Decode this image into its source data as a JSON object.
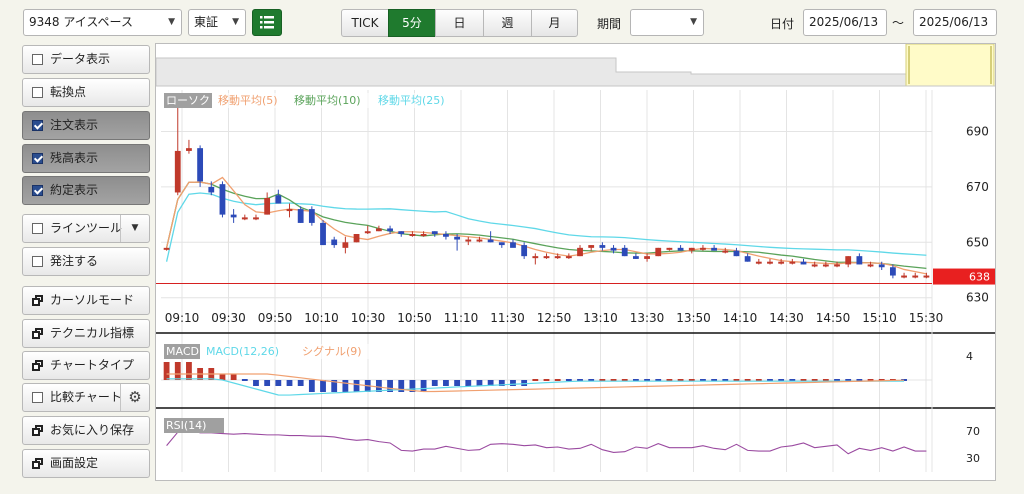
{
  "toolbar": {
    "symbol": "9348 アイスペース",
    "exchange": "東証",
    "list_icon": "list-icon",
    "periods": [
      "TICK",
      "5分",
      "日",
      "週",
      "月"
    ],
    "active_period": "5分",
    "period_label": "期間",
    "period_value": "",
    "date_label": "日付",
    "date_from": "2025/06/13",
    "tilde": "〜",
    "date_to": "2025/06/13"
  },
  "sidebar": {
    "items": [
      {
        "label": "データ表示",
        "kind": "check",
        "checked": false
      },
      {
        "label": "転換点",
        "kind": "check",
        "checked": false
      },
      {
        "label": "注文表示",
        "kind": "check",
        "checked": true
      },
      {
        "label": "残高表示",
        "kind": "check",
        "checked": true
      },
      {
        "label": "約定表示",
        "kind": "check",
        "checked": true
      },
      {
        "label": "ラインツール",
        "kind": "check-dropdown",
        "checked": false
      },
      {
        "label": "発注する",
        "kind": "check",
        "checked": false
      },
      {
        "label": "カーソルモード",
        "kind": "window"
      },
      {
        "label": "テクニカル指標",
        "kind": "window"
      },
      {
        "label": "チャートタイプ",
        "kind": "window"
      },
      {
        "label": "比較チャート",
        "kind": "check-gear",
        "checked": false
      },
      {
        "label": "お気に入り保存",
        "kind": "window"
      },
      {
        "label": "画面設定",
        "kind": "window"
      }
    ]
  },
  "main_chart": {
    "legend": [
      "ローソク",
      "移動平均(5)",
      "移動平均(10)",
      "移動平均(25)"
    ],
    "price_ticks": [
      "690",
      "670",
      "650",
      "630"
    ],
    "current_price": "638",
    "time_labels": [
      "09:10",
      "09:30",
      "09:50",
      "10:10",
      "10:30",
      "10:50",
      "11:10",
      "11:30",
      "12:50",
      "13:10",
      "13:30",
      "13:50",
      "14:10",
      "14:30",
      "14:50",
      "15:10",
      "15:30"
    ]
  },
  "macd": {
    "legend": [
      "MACD",
      "MACD(12,26)",
      "シグナル(9)"
    ],
    "tick": "4"
  },
  "rsi": {
    "legend": [
      "RSI(14)"
    ],
    "ticks": [
      "70",
      "30"
    ]
  },
  "colors": {
    "up": "#c0392b",
    "down": "#2c4ab8",
    "ma5": "#f0a070",
    "ma10": "#5aa35a",
    "ma25": "#5fd8e8",
    "macd": "#5fd8e8",
    "signal": "#f0a070",
    "rsi": "#9a4aa0",
    "active_green": "#1f7a2e"
  },
  "chart_data": {
    "type": "candlestick",
    "candles": [
      {
        "o": 648,
        "h": 648,
        "l": 647,
        "c": 648
      },
      {
        "o": 668,
        "h": 700,
        "l": 667,
        "c": 683
      },
      {
        "o": 683,
        "h": 687,
        "l": 682,
        "c": 684
      },
      {
        "o": 684,
        "h": 685,
        "l": 670,
        "c": 672
      },
      {
        "o": 670,
        "h": 672,
        "l": 667,
        "c": 668
      },
      {
        "o": 671,
        "h": 672,
        "l": 659,
        "c": 660
      },
      {
        "o": 660,
        "h": 662,
        "l": 657,
        "c": 659
      },
      {
        "o": 659,
        "h": 660,
        "l": 658,
        "c": 659
      },
      {
        "o": 659,
        "h": 660,
        "l": 658,
        "c": 659
      },
      {
        "o": 660,
        "h": 668,
        "l": 660,
        "c": 666
      },
      {
        "o": 667,
        "h": 669,
        "l": 664,
        "c": 664
      },
      {
        "o": 662,
        "h": 664,
        "l": 659,
        "c": 662
      },
      {
        "o": 662,
        "h": 663,
        "l": 657,
        "c": 657
      },
      {
        "o": 662,
        "h": 663,
        "l": 656,
        "c": 657
      },
      {
        "o": 657,
        "h": 658,
        "l": 649,
        "c": 649
      },
      {
        "o": 651,
        "h": 652,
        "l": 648,
        "c": 649
      },
      {
        "o": 648,
        "h": 652,
        "l": 646,
        "c": 650
      },
      {
        "o": 650,
        "h": 653,
        "l": 650,
        "c": 653
      },
      {
        "o": 654,
        "h": 656,
        "l": 653,
        "c": 654
      },
      {
        "o": 654,
        "h": 656,
        "l": 654,
        "c": 655
      },
      {
        "o": 655,
        "h": 656,
        "l": 653,
        "c": 654
      },
      {
        "o": 654,
        "h": 654,
        "l": 652,
        "c": 653
      },
      {
        "o": 653,
        "h": 654,
        "l": 652,
        "c": 653
      },
      {
        "o": 653,
        "h": 654,
        "l": 652,
        "c": 653
      },
      {
        "o": 654,
        "h": 654,
        "l": 652,
        "c": 653
      },
      {
        "o": 653,
        "h": 654,
        "l": 651,
        "c": 652
      },
      {
        "o": 652,
        "h": 653,
        "l": 647,
        "c": 651
      },
      {
        "o": 651,
        "h": 652,
        "l": 649,
        "c": 651
      },
      {
        "o": 651,
        "h": 652,
        "l": 650,
        "c": 651
      },
      {
        "o": 651,
        "h": 654,
        "l": 650,
        "c": 650
      },
      {
        "o": 650,
        "h": 650,
        "l": 648,
        "c": 649
      },
      {
        "o": 650,
        "h": 651,
        "l": 649,
        "c": 648
      },
      {
        "o": 649,
        "h": 650,
        "l": 644,
        "c": 645
      },
      {
        "o": 645,
        "h": 646,
        "l": 642,
        "c": 645
      },
      {
        "o": 645,
        "h": 646,
        "l": 644,
        "c": 645
      },
      {
        "o": 645,
        "h": 646,
        "l": 644,
        "c": 645
      },
      {
        "o": 645,
        "h": 646,
        "l": 644,
        "c": 645
      },
      {
        "o": 645,
        "h": 649,
        "l": 645,
        "c": 648
      },
      {
        "o": 648,
        "h": 649,
        "l": 647,
        "c": 649
      },
      {
        "o": 649,
        "h": 650,
        "l": 647,
        "c": 648
      },
      {
        "o": 648,
        "h": 649,
        "l": 646,
        "c": 647
      },
      {
        "o": 648,
        "h": 649,
        "l": 645,
        "c": 645
      },
      {
        "o": 645,
        "h": 646,
        "l": 644,
        "c": 644
      },
      {
        "o": 644,
        "h": 646,
        "l": 643,
        "c": 645
      },
      {
        "o": 645,
        "h": 648,
        "l": 645,
        "c": 648
      },
      {
        "o": 648,
        "h": 648,
        "l": 647,
        "c": 648
      },
      {
        "o": 648,
        "h": 649,
        "l": 647,
        "c": 647
      },
      {
        "o": 647,
        "h": 648,
        "l": 646,
        "c": 648
      },
      {
        "o": 648,
        "h": 649,
        "l": 647,
        "c": 648
      },
      {
        "o": 648,
        "h": 649,
        "l": 647,
        "c": 647
      },
      {
        "o": 647,
        "h": 648,
        "l": 646,
        "c": 647
      },
      {
        "o": 647,
        "h": 648,
        "l": 645,
        "c": 645
      },
      {
        "o": 645,
        "h": 646,
        "l": 643,
        "c": 643
      },
      {
        "o": 643,
        "h": 644,
        "l": 642,
        "c": 643
      },
      {
        "o": 643,
        "h": 644,
        "l": 642,
        "c": 643
      },
      {
        "o": 643,
        "h": 644,
        "l": 642,
        "c": 643
      },
      {
        "o": 643,
        "h": 644,
        "l": 642,
        "c": 643
      },
      {
        "o": 643,
        "h": 644,
        "l": 642,
        "c": 642
      },
      {
        "o": 642,
        "h": 643,
        "l": 641,
        "c": 642
      },
      {
        "o": 642,
        "h": 643,
        "l": 641,
        "c": 642
      },
      {
        "o": 642,
        "h": 643,
        "l": 641,
        "c": 642
      },
      {
        "o": 642,
        "h": 645,
        "l": 641,
        "c": 645
      },
      {
        "o": 645,
        "h": 646,
        "l": 642,
        "c": 642
      },
      {
        "o": 642,
        "h": 643,
        "l": 641,
        "c": 642
      },
      {
        "o": 642,
        "h": 643,
        "l": 640,
        "c": 641
      },
      {
        "o": 641,
        "h": 642,
        "l": 637,
        "c": 638
      },
      {
        "o": 638,
        "h": 639,
        "l": 637,
        "c": 638
      },
      {
        "o": 638,
        "h": 639,
        "l": 637,
        "c": 638
      },
      {
        "o": 638,
        "h": 639,
        "l": 637,
        "c": 638
      }
    ],
    "ylim": [
      627,
      705
    ],
    "macd_bars": [
      3,
      3,
      3,
      2,
      2,
      1,
      1,
      0,
      -1,
      -1,
      -1,
      -1,
      -1,
      -2,
      -2,
      -2,
      -2,
      -2,
      -2,
      -2,
      -2,
      -2,
      -2,
      -2,
      -1,
      -1,
      -1,
      -1,
      -1,
      -1,
      -1,
      -1,
      -1,
      0,
      0,
      0,
      0,
      0,
      0,
      0,
      0,
      0,
      0,
      0,
      0,
      0,
      0,
      0,
      0,
      0,
      0,
      0,
      0,
      0,
      0,
      0,
      0,
      0,
      0,
      0,
      0,
      0,
      0,
      0,
      0,
      0,
      0
    ],
    "macd_ylim": [
      -4,
      6
    ],
    "rsi": [
      48,
      68,
      72,
      67,
      67,
      66,
      65,
      66,
      65,
      64,
      64,
      63,
      63,
      62,
      62,
      61,
      58,
      56,
      57,
      54,
      52,
      41,
      40,
      43,
      43,
      47,
      44,
      41,
      42,
      50,
      51,
      50,
      48,
      49,
      45,
      46,
      43,
      44,
      50,
      42,
      38,
      39,
      46,
      44,
      51,
      45,
      45,
      45,
      48,
      44,
      42,
      50,
      41,
      40,
      40,
      46,
      48,
      52,
      45,
      47,
      49,
      36,
      44,
      41,
      45,
      40,
      46,
      40,
      40
    ],
    "rsi_ylim": [
      0,
      95
    ]
  }
}
